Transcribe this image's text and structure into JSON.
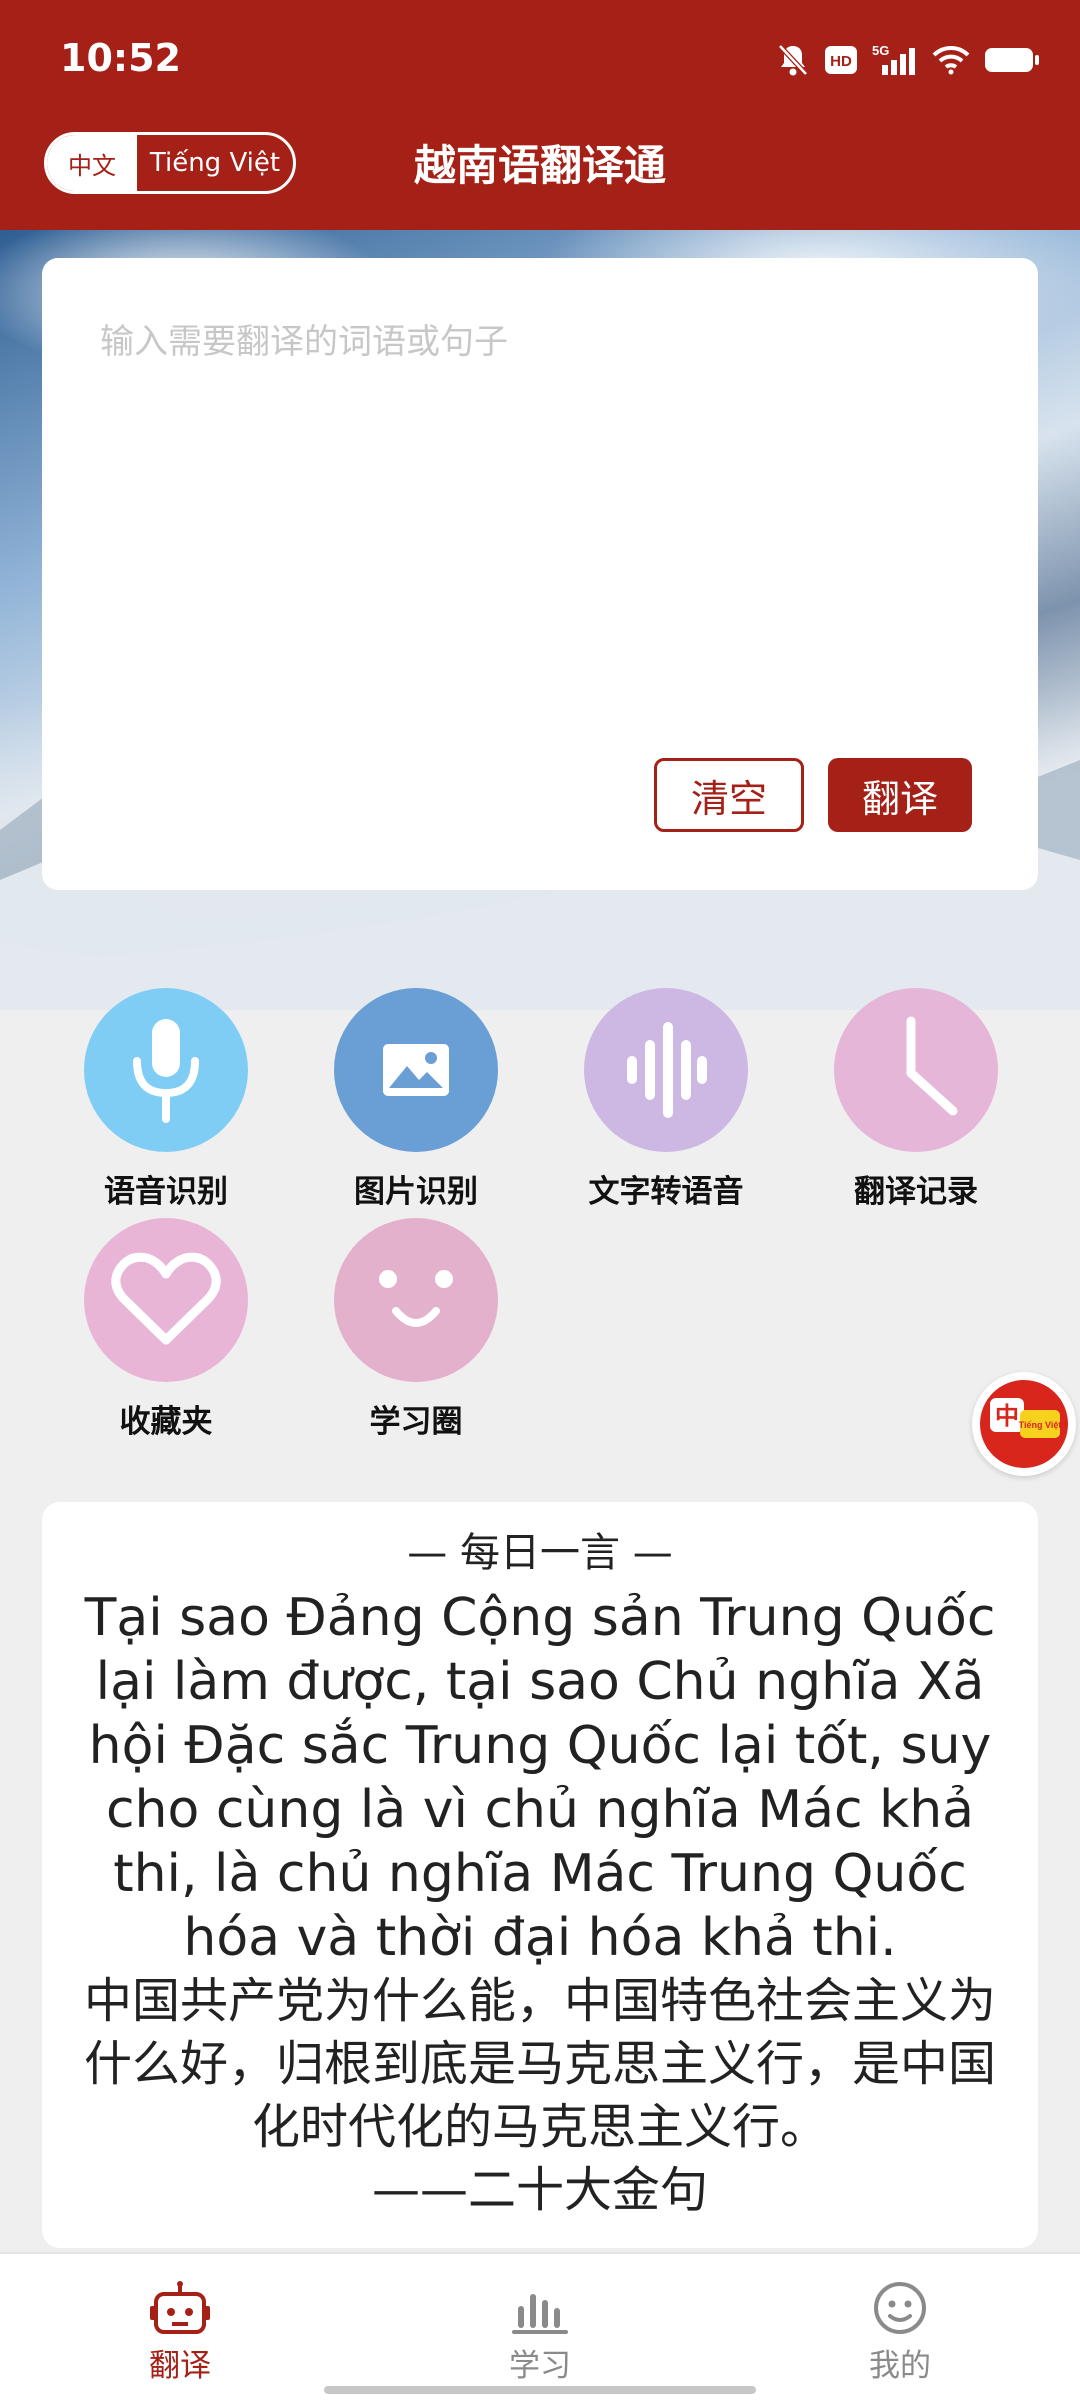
{
  "status_bar": {
    "time": "10:52",
    "network_label": "5G",
    "hd_label": "HD",
    "icons": [
      "mute-bell-icon",
      "hd-icon",
      "signal-icon",
      "wifi-icon",
      "battery-icon"
    ]
  },
  "header": {
    "title": "越南语翻译通",
    "lang_toggle": {
      "left": "中文",
      "right": "Tiếng Việt",
      "selected": "中文"
    }
  },
  "input": {
    "placeholder": "输入需要翻译的词语或句子",
    "clear_label": "清空",
    "translate_label": "翻译"
  },
  "features": [
    {
      "label": "语音识别",
      "icon": "microphone-icon",
      "color": "#7fcdf5"
    },
    {
      "label": "图片识别",
      "icon": "image-icon",
      "color": "#6a9fd6"
    },
    {
      "label": "文字转语音",
      "icon": "waveform-icon",
      "color": "#cdb7e3"
    },
    {
      "label": "翻译记录",
      "icon": "clock-icon",
      "color": "#e6b6d8"
    },
    {
      "label": "收藏夹",
      "icon": "heart-icon",
      "color": "#e8b5d6"
    },
    {
      "label": "学习圈",
      "icon": "smiley-icon",
      "color": "#e3b1cc"
    }
  ],
  "float_badge": {
    "label_zh": "中",
    "label_vi": "Tiếng Việt"
  },
  "daily_quote": {
    "heading": "— 每日一言 —",
    "vietnamese": "Tại sao Đảng Cộng sản Trung Quốc lại làm được, tại sao Chủ nghĩa Xã hội Đặc sắc Trung Quốc lại tốt, suy cho cùng là vì chủ nghĩa Mác khả thi, là chủ nghĩa Mác Trung Quốc hóa và thời đại hóa khả thi.",
    "chinese": "中国共产党为什么能，中国特色社会主义为什么好，归根到底是马克思主义行，是中国化时代化的马克思主义行。",
    "source": "——二十大金句"
  },
  "tabbar": {
    "items": [
      {
        "label": "翻译",
        "icon": "robot-icon",
        "active": true
      },
      {
        "label": "学习",
        "icon": "bar-chart-icon",
        "active": false
      },
      {
        "label": "我的",
        "icon": "user-face-icon",
        "active": false
      }
    ]
  },
  "colors": {
    "brand_red": "#a52016",
    "inactive_gray": "#8a8a8a"
  }
}
